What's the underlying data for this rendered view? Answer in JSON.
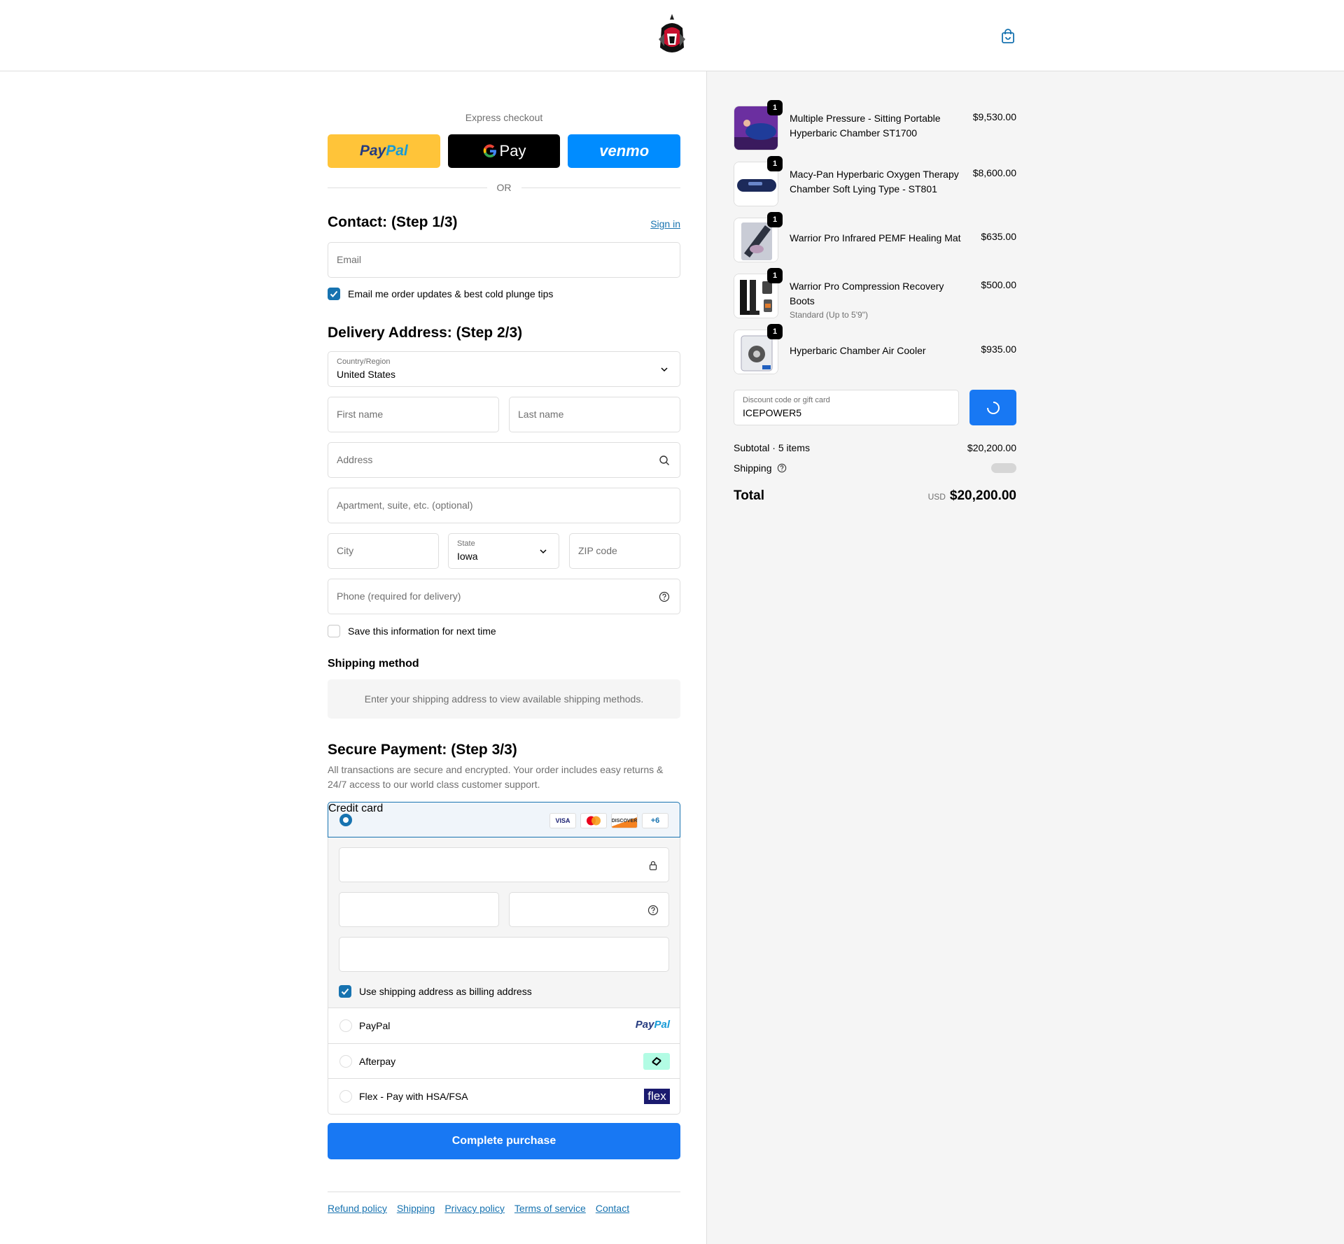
{
  "header": {
    "logo": "knight-helmet-logo",
    "cart_icon": "shopping-bag-icon"
  },
  "express": {
    "label": "Express checkout",
    "paypal_pay": "Pay",
    "paypal_pal": "Pal",
    "gpay_label": "Pay",
    "venmo_label": "venmo",
    "or_label": "OR"
  },
  "contact": {
    "title": "Contact: (Step 1/3)",
    "sign_in": "Sign in",
    "email_placeholder": "Email",
    "email_updates": "Email me order updates & best cold plunge tips"
  },
  "delivery": {
    "title": "Delivery Address: (Step 2/3)",
    "country_label": "Country/Region",
    "country_value": "United States",
    "first_name": "First name",
    "last_name": "Last name",
    "address": "Address",
    "apartment": "Apartment, suite, etc. (optional)",
    "city": "City",
    "state_label": "State",
    "state_value": "Iowa",
    "zip": "ZIP code",
    "phone": "Phone (required for delivery)",
    "save_info": "Save this information for next time"
  },
  "shipping_method": {
    "title": "Shipping method",
    "message": "Enter your shipping address to view available shipping methods."
  },
  "payment": {
    "title": "Secure Payment: (Step 3/3)",
    "description": "All transactions are secure and encrypted. Your order includes easy returns & 24/7 access to our world class customer support.",
    "credit_card": "Credit card",
    "card_logos": [
      "VISA",
      "",
      "DISCOVER",
      "+6"
    ],
    "billing_same": "Use shipping address as billing address",
    "paypal": "PayPal",
    "paypal_logo_pay": "Pay",
    "paypal_logo_pal": "Pal",
    "afterpay": "Afterpay",
    "flex": "Flex - Pay with HSA/FSA",
    "flex_logo": "flex"
  },
  "complete_button": "Complete purchase",
  "footer": [
    "Refund policy",
    "Shipping",
    "Privacy policy",
    "Terms of service",
    "Contact"
  ],
  "order": {
    "items": [
      {
        "name": "Multiple Pressure - Sitting Portable Hyperbaric Chamber ST1700",
        "price": "$9,530.00",
        "qty": "1",
        "variant": ""
      },
      {
        "name": "Macy-Pan Hyperbaric Oxygen Therapy Chamber Soft Lying Type - ST801",
        "price": "$8,600.00",
        "qty": "1",
        "variant": ""
      },
      {
        "name": "Warrior Pro Infrared PEMF Healing Mat",
        "price": "$635.00",
        "qty": "1",
        "variant": ""
      },
      {
        "name": "Warrior Pro Compression Recovery Boots",
        "price": "$500.00",
        "qty": "1",
        "variant": "Standard (Up to 5'9\")"
      },
      {
        "name": "Hyperbaric Chamber Air Cooler",
        "price": "$935.00",
        "qty": "1",
        "variant": ""
      }
    ],
    "discount_label": "Discount code or gift card",
    "discount_value": "ICEPOWER5",
    "subtotal_label": "Subtotal · 5 items",
    "subtotal_value": "$20,200.00",
    "shipping_label": "Shipping",
    "total_label": "Total",
    "currency": "USD",
    "total_value": "$20,200.00"
  },
  "colors": {
    "accent": "#1773b0",
    "button": "#1878f3",
    "paypal": "#ffc439",
    "venmo": "#008cff",
    "flex": "#1a1a6e",
    "afterpay": "#b2fce4"
  }
}
